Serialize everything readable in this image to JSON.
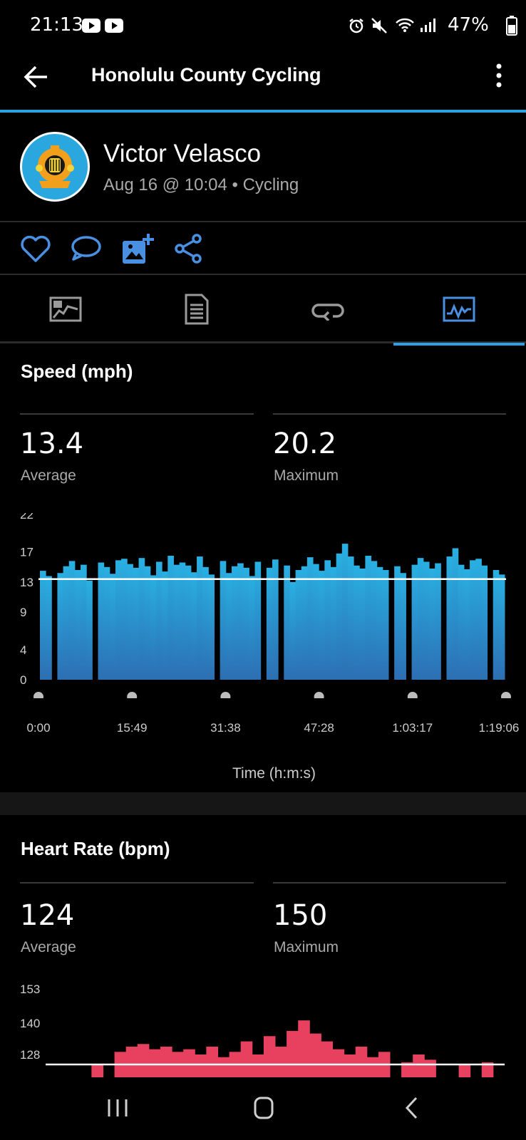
{
  "status_bar": {
    "time": "21:13",
    "battery": "47%"
  },
  "app_bar": {
    "title": "Honolulu County Cycling"
  },
  "profile": {
    "name": "Victor Velasco",
    "meta": "Aug 16 @ 10:04 • Cycling"
  },
  "actions": [
    "heart-icon",
    "comment-icon",
    "add-photo-icon",
    "share-icon"
  ],
  "tabs": [
    "map-tab",
    "details-tab",
    "laps-tab",
    "charts-tab"
  ],
  "active_tab": 3,
  "colors": {
    "accent": "#2e9fe0",
    "speed": "#2aa3d8",
    "heart": "#e8405f"
  },
  "speed": {
    "title": "Speed (mph)",
    "average": {
      "value": "13.4",
      "label": "Average"
    },
    "maximum": {
      "value": "20.2",
      "label": "Maximum"
    },
    "x_axis_label": "Time (h:m:s)"
  },
  "heart_rate": {
    "title": "Heart Rate (bpm)",
    "average": {
      "value": "124",
      "label": "Average"
    },
    "maximum": {
      "value": "150",
      "label": "Maximum"
    }
  },
  "chart_data": [
    {
      "type": "area",
      "title": "Speed (mph)",
      "xlabel": "Time (h:m:s)",
      "ylabel": "",
      "x_ticks": [
        "0:00",
        "15:49",
        "31:38",
        "47:28",
        "1:03:17",
        "1:19:06"
      ],
      "y_ticks": [
        "0",
        "4",
        "9",
        "13",
        "17",
        "22"
      ],
      "ylim": [
        0,
        22
      ],
      "x_minutes": [
        0,
        1,
        2,
        3,
        4,
        5,
        6,
        7,
        8,
        9,
        10,
        11,
        12,
        13,
        14,
        15,
        16,
        17,
        18,
        19,
        20,
        21,
        22,
        23,
        24,
        25,
        26,
        27,
        28,
        29,
        30,
        31,
        32,
        33,
        34,
        35,
        36,
        37,
        38,
        39,
        40,
        41,
        42,
        43,
        44,
        45,
        46,
        47,
        48,
        49,
        50,
        51,
        52,
        53,
        54,
        55,
        56,
        57,
        58,
        59,
        60,
        61,
        62,
        63,
        64,
        65,
        66,
        67,
        68,
        69,
        70,
        71,
        72,
        73,
        74,
        75,
        76,
        77,
        78,
        79
      ],
      "values": [
        14.5,
        13.8,
        0,
        14.2,
        15.1,
        15.8,
        14.6,
        15.3,
        13.2,
        0,
        15.6,
        15.0,
        14.1,
        15.9,
        16.1,
        15.4,
        14.9,
        16.2,
        15.1,
        13.9,
        15.7,
        14.4,
        16.5,
        15.3,
        15.6,
        15.2,
        14.3,
        16.4,
        15.0,
        14.0,
        0,
        15.8,
        14.2,
        15.1,
        15.5,
        14.9,
        13.8,
        15.7,
        0,
        14.9,
        16.0,
        0,
        15.2,
        13.0,
        14.6,
        15.1,
        16.3,
        15.4,
        14.5,
        15.9,
        15.0,
        16.8,
        18.1,
        16.4,
        15.2,
        14.8,
        16.5,
        15.8,
        15.0,
        14.6,
        0,
        15.1,
        14.2,
        0,
        15.3,
        16.2,
        15.7,
        14.8,
        15.5,
        0,
        16.4,
        17.5,
        15.3,
        14.7,
        15.9,
        16.1,
        15.2,
        0,
        14.6,
        14.0
      ],
      "reference_line": 13.4
    },
    {
      "type": "area",
      "title": "Heart Rate (bpm)",
      "y_ticks": [
        "128",
        "140",
        "153"
      ],
      "x_minutes": [
        0,
        2,
        4,
        6,
        8,
        10,
        12,
        14,
        16,
        18,
        20,
        22,
        24,
        26,
        28,
        30,
        32,
        34,
        36,
        38,
        40,
        42,
        44,
        46,
        48,
        50,
        52,
        54,
        56,
        58,
        60,
        62,
        64,
        66,
        68,
        70,
        72,
        74,
        76,
        78
      ],
      "values": [
        0,
        0,
        0,
        0,
        124,
        0,
        129,
        131,
        132,
        130,
        131,
        129,
        130,
        128,
        131,
        127,
        129,
        133,
        128,
        135,
        131,
        137,
        141,
        136,
        133,
        130,
        128,
        131,
        127,
        129,
        0,
        125,
        128,
        126,
        0,
        0,
        124,
        0,
        125,
        0
      ],
      "reference_line": 124
    }
  ]
}
